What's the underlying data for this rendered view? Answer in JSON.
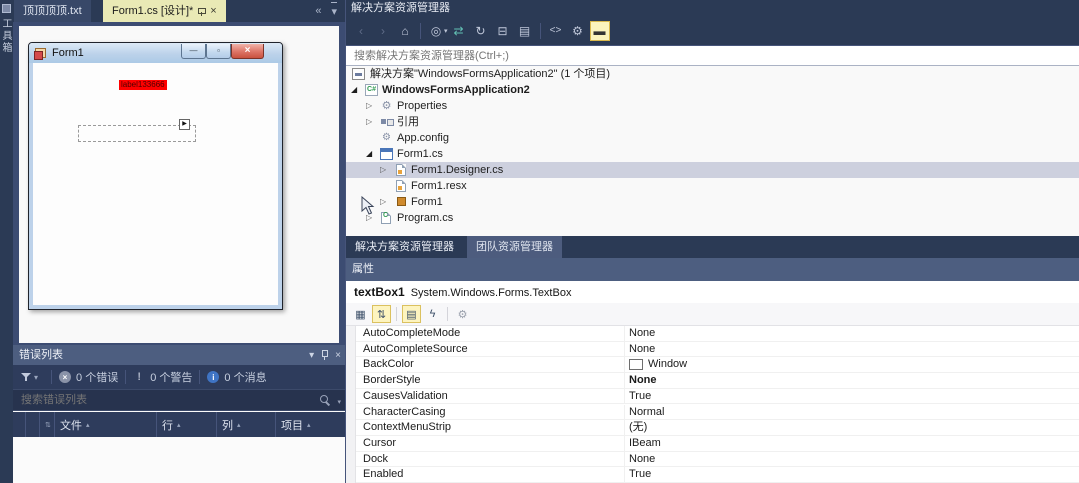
{
  "colors": {
    "shell_background": "#2b3a55",
    "panel_header": "#4d5e80",
    "active_tab": "#e9e9b5",
    "tree_selection": "#cdd0de",
    "designer_label_background": "#ff0000",
    "toolbar_highlight": "#fbf3bc"
  },
  "glyphs": {
    "expanded": "◢",
    "collapsed": "▷",
    "overflow_left": "«",
    "dropdown": "▾",
    "close": "×",
    "sort_asc": "▴",
    "minimize": "—",
    "maximize": "▫",
    "smart_tag": "▶"
  },
  "dock_left": {
    "vertical_tab_label": "工具箱"
  },
  "document_tabs": {
    "inactive_tab": "顶顶顶顶.txt",
    "active_tab": "Form1.cs [设计]*"
  },
  "designer": {
    "form_title": "Form1",
    "label_text": "label133666"
  },
  "error_list": {
    "title": "错误列表",
    "errors_label": "0 个错误",
    "warnings_label": "0 个警告",
    "messages_label": "0 个消息",
    "search_placeholder": "搜索错误列表",
    "columns": [
      "文件",
      "行",
      "列",
      "项目"
    ]
  },
  "solution_explorer": {
    "title": "解决方案资源管理器",
    "search_placeholder": "搜索解决方案资源管理器(Ctrl+;)",
    "toolbar_icons": [
      {
        "name": "back",
        "glyph": "‹"
      },
      {
        "name": "forward",
        "glyph": "›"
      },
      {
        "name": "home",
        "glyph": "⌂"
      },
      {
        "name": "switch-views",
        "glyph": "◎"
      },
      {
        "name": "sync-with-active-document",
        "glyph": "⇄"
      },
      {
        "name": "refresh",
        "glyph": "↻"
      },
      {
        "name": "collapse-all",
        "glyph": "⊟"
      },
      {
        "name": "show-all-files",
        "glyph": "▤"
      },
      {
        "name": "view-code",
        "glyph": "<>"
      },
      {
        "name": "properties",
        "glyph": "⚙"
      },
      {
        "name": "preview-selected-items",
        "glyph": "▬"
      }
    ],
    "tree": [
      {
        "label": "解决方案\"WindowsFormsApplication2\" (1 个项目)"
      },
      {
        "label": "WindowsFormsApplication2"
      },
      {
        "label": "Properties"
      },
      {
        "label": "引用"
      },
      {
        "label": "App.config"
      },
      {
        "label": "Form1.cs"
      },
      {
        "label": "Form1.Designer.cs"
      },
      {
        "label": "Form1.resx"
      },
      {
        "label": "Form1"
      },
      {
        "label": "Program.cs"
      }
    ],
    "bottom_tabs": {
      "active": "解决方案资源管理器",
      "inactive": "团队资源管理器"
    }
  },
  "properties_panel": {
    "title": "属性",
    "object_name": "textBox1",
    "object_type": "System.Windows.Forms.TextBox",
    "toolbar_icons": [
      {
        "name": "categorized",
        "glyph": "▦"
      },
      {
        "name": "alphabetical",
        "glyph": "⇅"
      },
      {
        "name": "properties",
        "glyph": "▤"
      },
      {
        "name": "events",
        "glyph": "ϟ"
      },
      {
        "name": "property-pages",
        "glyph": "⚙"
      }
    ],
    "rows": [
      {
        "name": "AutoCompleteMode",
        "value": "None"
      },
      {
        "name": "AutoCompleteSource",
        "value": "None"
      },
      {
        "name": "BackColor",
        "value": "Window"
      },
      {
        "name": "BorderStyle",
        "value": "None"
      },
      {
        "name": "CausesValidation",
        "value": "True"
      },
      {
        "name": "CharacterCasing",
        "value": "Normal"
      },
      {
        "name": "ContextMenuStrip",
        "value": "(无)"
      },
      {
        "name": "Cursor",
        "value": "IBeam"
      },
      {
        "name": "Dock",
        "value": "None"
      },
      {
        "name": "Enabled",
        "value": "True"
      }
    ]
  }
}
